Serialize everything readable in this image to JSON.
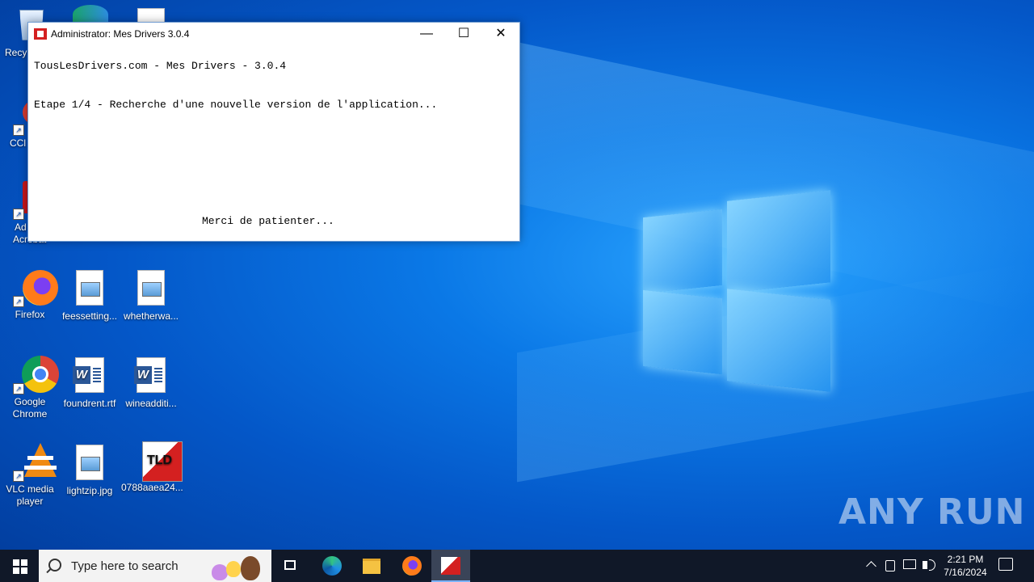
{
  "window": {
    "title": "Administrator:  Mes Drivers 3.0.4",
    "minimize_glyph": "—",
    "maximize_glyph": "☐",
    "close_glyph": "✕",
    "console_line1": "TousLesDrivers.com - Mes Drivers - 3.0.4",
    "console_line2": "Etape 1/4 - Recherche d'une nouvelle version de l'application...",
    "console_line3": "Merci de patienter..."
  },
  "desktop_icons": {
    "recycle": "Recy",
    "ccleaner": "CCl",
    "acrobat_line1": "Ad",
    "acrobat_line2": "Acrobat",
    "firefox": "Firefox",
    "feessetting": "feessetting...",
    "whetherwa": "whetherwa...",
    "chrome_line1": "Google",
    "chrome_line2": "Chrome",
    "foundrent": "foundrent.rtf",
    "wineadditi": "wineadditi...",
    "vlc_line1": "VLC media",
    "vlc_line2": "player",
    "lightzip": "lightzip.jpg",
    "exe_file": "0788aaea24..."
  },
  "taskbar": {
    "search_placeholder": "Type here to search",
    "time": "2:21 PM",
    "date": "7/16/2024",
    "icons": [
      "windows-start-icon",
      "task-view-icon",
      "edge-icon",
      "file-explorer-icon",
      "firefox-icon",
      "tld-app-icon"
    ]
  },
  "watermark": "ANY RUN",
  "colors": {
    "desktop_blue": "#0a78e6",
    "taskbar": "#101828",
    "tld_red": "#d42020"
  }
}
